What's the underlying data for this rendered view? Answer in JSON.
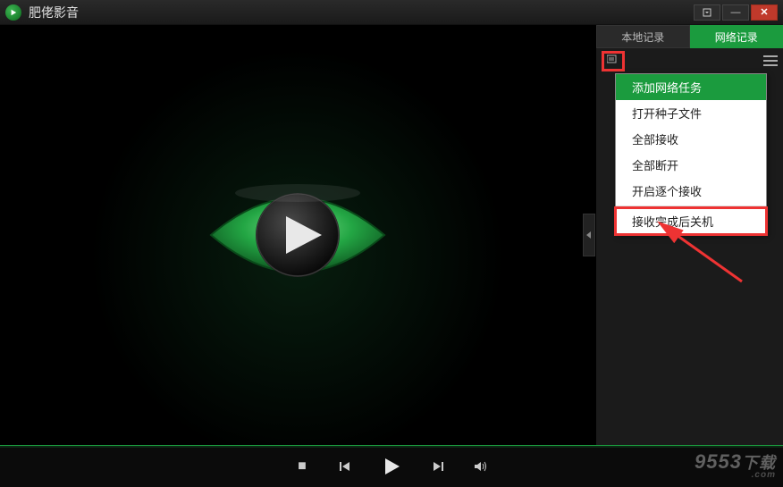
{
  "app": {
    "title": "肥佬影音"
  },
  "titlebar": {
    "dropdown_label": "▾",
    "minimize_label": "—",
    "close_label": "✕"
  },
  "sidebar": {
    "tabs": {
      "local": "本地记录",
      "network": "网络记录"
    }
  },
  "context_menu": {
    "items": [
      "添加网络任务",
      "打开种子文件",
      "全部接收",
      "全部断开",
      "开启逐个接收",
      "接收完成后关机"
    ]
  },
  "controls": {
    "stop": "■"
  },
  "watermark": {
    "text": "9553",
    "suffix": "下载",
    "dotcom": ".com"
  }
}
